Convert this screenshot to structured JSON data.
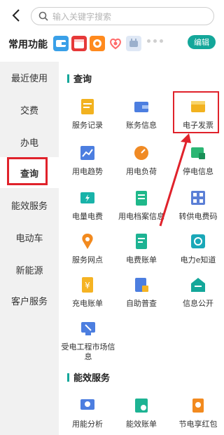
{
  "search": {
    "placeholder": "输入关键字搜索"
  },
  "common_functions": {
    "title": "常用功能",
    "edit_label": "编辑",
    "quick_icons": [
      "wallet-icon",
      "calendar-icon",
      "orange-card-icon",
      "heart-icon",
      "plug-icon"
    ]
  },
  "sidebar": {
    "items": [
      {
        "label": "最近使用"
      },
      {
        "label": "交费"
      },
      {
        "label": "办电"
      },
      {
        "label": "查询",
        "active": true
      },
      {
        "label": "能效服务"
      },
      {
        "label": "电动车"
      },
      {
        "label": "新能源"
      },
      {
        "label": "客户服务"
      }
    ]
  },
  "sections": [
    {
      "title": "查询",
      "items": [
        {
          "label": "服务记录",
          "icon": "clipboard-icon"
        },
        {
          "label": "账务信息",
          "icon": "wallet-icon"
        },
        {
          "label": "电子发票",
          "icon": "invoice-icon"
        },
        {
          "label": "用电趋势",
          "icon": "trend-chart-icon"
        },
        {
          "label": "用电负荷",
          "icon": "gauge-icon"
        },
        {
          "label": "停电信息",
          "icon": "outage-icon"
        },
        {
          "label": "电量电费",
          "icon": "battery-icon"
        },
        {
          "label": "用电档案信息",
          "icon": "file-icon"
        },
        {
          "label": "转供电费码",
          "icon": "qr-code-icon"
        },
        {
          "label": "服务网点",
          "icon": "location-icon"
        },
        {
          "label": "电费账单",
          "icon": "bill-icon"
        },
        {
          "label": "电力e知道",
          "icon": "knowledge-icon"
        },
        {
          "label": "充电账单",
          "icon": "charge-bill-icon"
        },
        {
          "label": "自助普查",
          "icon": "self-check-icon"
        },
        {
          "label": "信息公开",
          "icon": "disclosure-icon"
        },
        {
          "label": "受电工程市场信息",
          "icon": "project-market-icon"
        }
      ]
    },
    {
      "title": "能效服务",
      "items": [
        {
          "label": "用能分析",
          "icon": "energy-analysis-icon"
        },
        {
          "label": "能效账单",
          "icon": "efficiency-bill-icon"
        },
        {
          "label": "节电享红包",
          "icon": "red-envelope-icon"
        }
      ]
    }
  ],
  "colors": {
    "accent": "#14a79a",
    "highlight": "#e0222b",
    "sidebar_bg": "#f1f1f1"
  }
}
